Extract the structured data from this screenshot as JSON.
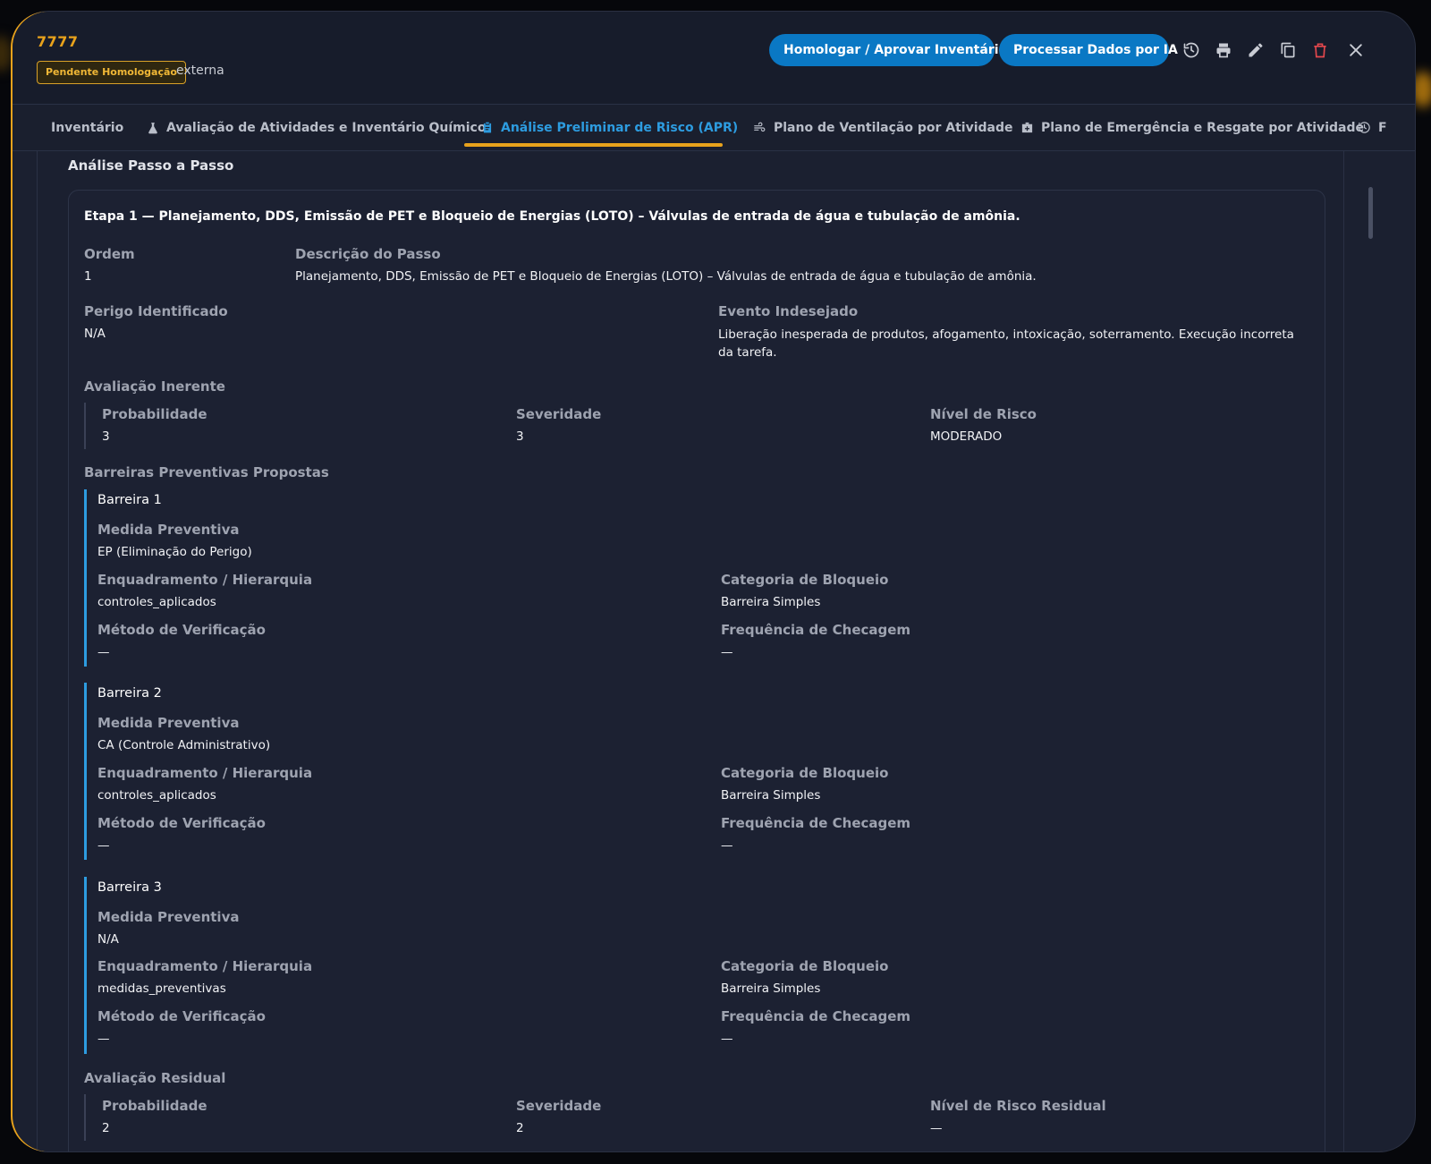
{
  "header": {
    "code": "7777",
    "status_badge": "Pendente Homologação",
    "origin": "externa",
    "approve_button": "Homologar / Aprovar Inventário",
    "ai_button": "Processar Dados por IA"
  },
  "tabs": [
    {
      "label": "Inventário",
      "icon": "none",
      "active": false
    },
    {
      "label": "Avaliação de Atividades e Inventário Químico",
      "icon": "flask-icon",
      "active": false
    },
    {
      "label": "Análise Preliminar de Risco (APR)",
      "icon": "clipboard-icon",
      "active": true
    },
    {
      "label": "Plano de Ventilação por Atividade",
      "icon": "wind-icon",
      "active": false
    },
    {
      "label": "Plano de Emergência e Resgate por Atividade",
      "icon": "medkit-icon",
      "active": false
    },
    {
      "label": "F",
      "icon": "history-icon",
      "active": false
    }
  ],
  "section_title": "Análise Passo a Passo",
  "step": {
    "title": "Etapa 1 — Planejamento, DDS, Emissão de PET e Bloqueio de Energias (LOTO) – Válvulas de entrada de água e tubulação de amônia.",
    "order_label": "Ordem",
    "order_value": "1",
    "description_label": "Descrição do Passo",
    "description_value": "Planejamento, DDS, Emissão de PET e Bloqueio de Energias (LOTO) – Válvulas de entrada de água e tubulação de amônia.",
    "hazard_label": "Perigo Identificado",
    "hazard_value": "N/A",
    "event_label": "Evento Indesejado",
    "event_value": "Liberação inesperada de produtos, afogamento, intoxicação, soterramento. Execução incorreta da tarefa.",
    "inherent": {
      "title": "Avaliação Inerente",
      "probability_label": "Probabilidade",
      "probability_value": "3",
      "severity_label": "Severidade",
      "severity_value": "3",
      "risk_label": "Nível de Risco",
      "risk_value": "MODERADO"
    },
    "barriers_title": "Barreiras Preventivas Propostas",
    "field_labels": {
      "measure": "Medida Preventiva",
      "framework": "Enquadramento / Hierarquia",
      "category": "Categoria de Bloqueio",
      "method": "Método de Verificação",
      "frequency": "Frequência de Checagem"
    },
    "barriers": [
      {
        "title": "Barreira 1",
        "measure": "EP (Eliminação do Perigo)",
        "framework": "controles_aplicados",
        "category": "Barreira Simples",
        "method": "—",
        "frequency": "—"
      },
      {
        "title": "Barreira 2",
        "measure": "CA (Controle Administrativo)",
        "framework": "controles_aplicados",
        "category": "Barreira Simples",
        "method": "—",
        "frequency": "—"
      },
      {
        "title": "Barreira 3",
        "measure": "N/A",
        "framework": "medidas_preventivas",
        "category": "Barreira Simples",
        "method": "—",
        "frequency": "—"
      }
    ],
    "residual": {
      "title": "Avaliação Residual",
      "probability_label": "Probabilidade",
      "probability_value": "2",
      "severity_label": "Severidade",
      "severity_value": "2",
      "risk_label": "Nível de Risco Residual",
      "risk_value": "—"
    }
  },
  "colors": {
    "accent": "#e8a21c",
    "primary": "#0a78c4",
    "active_tab": "#2d9ce0",
    "danger": "#e5484d",
    "background": "#1b2030"
  }
}
